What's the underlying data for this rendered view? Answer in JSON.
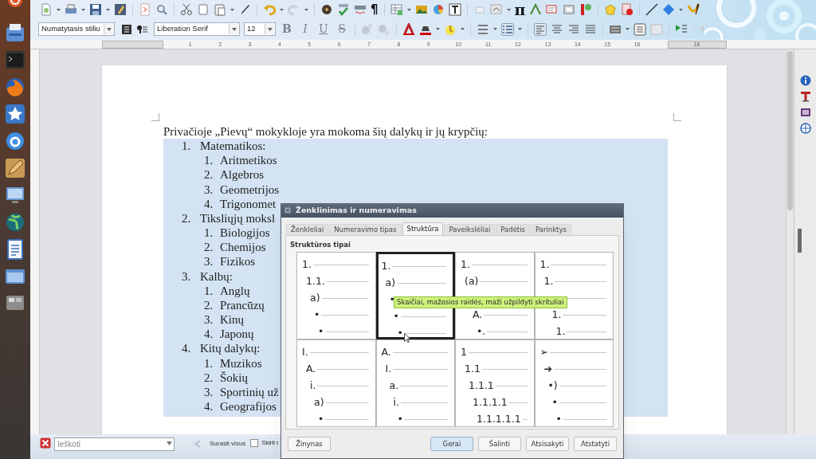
{
  "toolbar": {
    "pilcrow": "¶",
    "pi": "π",
    "paragraph_style": "Numatytasis stiliu",
    "font_name": "Liberation Serif",
    "font_size": "12",
    "format_buttons": [
      "B",
      "I",
      "U",
      "S"
    ]
  },
  "ruler": {
    "labels": [
      "1",
      "2",
      "3",
      "4",
      "5",
      "6",
      "7",
      "8",
      "9",
      "10",
      "11",
      "12",
      "13",
      "14",
      "15",
      "16"
    ],
    "end_label": "18"
  },
  "document": {
    "heading": "Privačioje „Pievų“ mokykloje yra mokoma šių dalykų ir jų krypčių:",
    "list": [
      {
        "number": "1.",
        "text": "Matematikos:",
        "children": [
          {
            "number": "1.",
            "text": "Aritmetikos"
          },
          {
            "number": "2.",
            "text": "Algebros"
          },
          {
            "number": "3.",
            "text": "Geometrijos"
          },
          {
            "number": "4.",
            "text": "Trigonomet"
          }
        ]
      },
      {
        "number": "2.",
        "text": "Tiksliųjų moksl",
        "children": [
          {
            "number": "1.",
            "text": "Biologijos"
          },
          {
            "number": "2.",
            "text": "Chemijos"
          },
          {
            "number": "3.",
            "text": "Fizikos"
          }
        ]
      },
      {
        "number": "3.",
        "text": "Kalbų:",
        "children": [
          {
            "number": "1.",
            "text": "Anglų"
          },
          {
            "number": "2.",
            "text": "Prancūzų"
          },
          {
            "number": "3.",
            "text": "Kinų"
          },
          {
            "number": "4.",
            "text": "Japonų"
          }
        ]
      },
      {
        "number": "4.",
        "text": "Kitų dalykų:",
        "children": [
          {
            "number": "1.",
            "text": "Muzikos"
          },
          {
            "number": "2.",
            "text": "Šokių"
          },
          {
            "number": "3.",
            "text": "Sportinių už"
          },
          {
            "number": "4.",
            "text": "Geografijos"
          }
        ]
      }
    ]
  },
  "find_bar": {
    "search": {
      "placeholder": "Ieškoti"
    },
    "find_all": "Surasti visus",
    "checkbox": {
      "label": "Skirti r",
      "checked": false
    }
  },
  "dialog": {
    "title": "Ženklinimas ir numeravimas",
    "tabs": [
      {
        "label": "Ženkleliai",
        "selected": false
      },
      {
        "label": "Numeravimo tipas",
        "selected": false
      },
      {
        "label": "Struktūra",
        "selected": true
      },
      {
        "label": "Paveikslėliai",
        "selected": false
      },
      {
        "label": "Padėtis",
        "selected": false
      },
      {
        "label": "Parinktys",
        "selected": false
      }
    ],
    "section_label": "Struktūros tipai",
    "presets": [
      {
        "selected": false,
        "lines": [
          "1.",
          "1.1.",
          "a)",
          "•",
          "•"
        ]
      },
      {
        "selected": true,
        "lines": [
          "1.",
          "a)",
          "•",
          "•",
          "•"
        ]
      },
      {
        "selected": false,
        "lines": [
          "1.",
          "(a)"
        ],
        "lines_below_tooltip": [
          "A.",
          "•."
        ]
      },
      {
        "selected": false,
        "lines": [
          "1.",
          "1."
        ],
        "lines_below_tooltip": [
          "1.",
          "1."
        ]
      },
      {
        "selected": false,
        "lines": [
          "I.",
          "A.",
          "i.",
          "a)",
          "•"
        ]
      },
      {
        "selected": false,
        "lines": [
          "A.",
          "I.",
          "a.",
          "i.",
          "•"
        ]
      },
      {
        "selected": false,
        "lines": [
          "1",
          "1.1",
          "1.1.1",
          "1.1.1.1",
          "1.1.1.1.1"
        ]
      },
      {
        "selected": false,
        "lines": [
          "➢",
          "➔",
          "•)",
          "•",
          "•"
        ]
      }
    ],
    "tooltip": "Skaičiai, mažosios raidės, maži užpildyti skrituliai",
    "buttons": [
      {
        "label": "Žinynas",
        "default": false
      },
      {
        "label": "Gerai",
        "default": true
      },
      {
        "label": "Šalinti",
        "default": false
      },
      {
        "label": "Atsisakyti",
        "default": false
      },
      {
        "label": "Atstatyti",
        "default": false
      }
    ]
  }
}
